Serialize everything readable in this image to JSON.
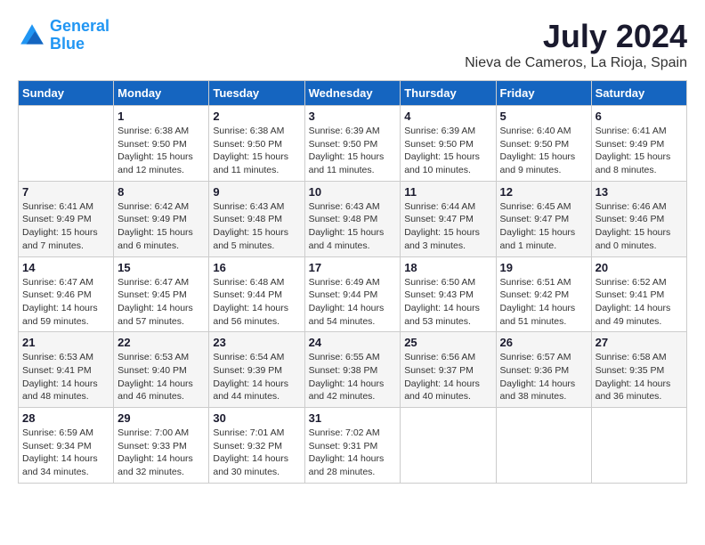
{
  "header": {
    "logo_line1": "General",
    "logo_line2": "Blue",
    "month": "July 2024",
    "location": "Nieva de Cameros, La Rioja, Spain"
  },
  "days_of_week": [
    "Sunday",
    "Monday",
    "Tuesday",
    "Wednesday",
    "Thursday",
    "Friday",
    "Saturday"
  ],
  "weeks": [
    [
      {
        "day": "",
        "content": ""
      },
      {
        "day": "1",
        "content": "Sunrise: 6:38 AM\nSunset: 9:50 PM\nDaylight: 15 hours and 12 minutes."
      },
      {
        "day": "2",
        "content": "Sunrise: 6:38 AM\nSunset: 9:50 PM\nDaylight: 15 hours and 11 minutes."
      },
      {
        "day": "3",
        "content": "Sunrise: 6:39 AM\nSunset: 9:50 PM\nDaylight: 15 hours and 11 minutes."
      },
      {
        "day": "4",
        "content": "Sunrise: 6:39 AM\nSunset: 9:50 PM\nDaylight: 15 hours and 10 minutes."
      },
      {
        "day": "5",
        "content": "Sunrise: 6:40 AM\nSunset: 9:50 PM\nDaylight: 15 hours and 9 minutes."
      },
      {
        "day": "6",
        "content": "Sunrise: 6:41 AM\nSunset: 9:49 PM\nDaylight: 15 hours and 8 minutes."
      }
    ],
    [
      {
        "day": "7",
        "content": "Sunrise: 6:41 AM\nSunset: 9:49 PM\nDaylight: 15 hours and 7 minutes."
      },
      {
        "day": "8",
        "content": "Sunrise: 6:42 AM\nSunset: 9:49 PM\nDaylight: 15 hours and 6 minutes."
      },
      {
        "day": "9",
        "content": "Sunrise: 6:43 AM\nSunset: 9:48 PM\nDaylight: 15 hours and 5 minutes."
      },
      {
        "day": "10",
        "content": "Sunrise: 6:43 AM\nSunset: 9:48 PM\nDaylight: 15 hours and 4 minutes."
      },
      {
        "day": "11",
        "content": "Sunrise: 6:44 AM\nSunset: 9:47 PM\nDaylight: 15 hours and 3 minutes."
      },
      {
        "day": "12",
        "content": "Sunrise: 6:45 AM\nSunset: 9:47 PM\nDaylight: 15 hours and 1 minute."
      },
      {
        "day": "13",
        "content": "Sunrise: 6:46 AM\nSunset: 9:46 PM\nDaylight: 15 hours and 0 minutes."
      }
    ],
    [
      {
        "day": "14",
        "content": "Sunrise: 6:47 AM\nSunset: 9:46 PM\nDaylight: 14 hours and 59 minutes."
      },
      {
        "day": "15",
        "content": "Sunrise: 6:47 AM\nSunset: 9:45 PM\nDaylight: 14 hours and 57 minutes."
      },
      {
        "day": "16",
        "content": "Sunrise: 6:48 AM\nSunset: 9:44 PM\nDaylight: 14 hours and 56 minutes."
      },
      {
        "day": "17",
        "content": "Sunrise: 6:49 AM\nSunset: 9:44 PM\nDaylight: 14 hours and 54 minutes."
      },
      {
        "day": "18",
        "content": "Sunrise: 6:50 AM\nSunset: 9:43 PM\nDaylight: 14 hours and 53 minutes."
      },
      {
        "day": "19",
        "content": "Sunrise: 6:51 AM\nSunset: 9:42 PM\nDaylight: 14 hours and 51 minutes."
      },
      {
        "day": "20",
        "content": "Sunrise: 6:52 AM\nSunset: 9:41 PM\nDaylight: 14 hours and 49 minutes."
      }
    ],
    [
      {
        "day": "21",
        "content": "Sunrise: 6:53 AM\nSunset: 9:41 PM\nDaylight: 14 hours and 48 minutes."
      },
      {
        "day": "22",
        "content": "Sunrise: 6:53 AM\nSunset: 9:40 PM\nDaylight: 14 hours and 46 minutes."
      },
      {
        "day": "23",
        "content": "Sunrise: 6:54 AM\nSunset: 9:39 PM\nDaylight: 14 hours and 44 minutes."
      },
      {
        "day": "24",
        "content": "Sunrise: 6:55 AM\nSunset: 9:38 PM\nDaylight: 14 hours and 42 minutes."
      },
      {
        "day": "25",
        "content": "Sunrise: 6:56 AM\nSunset: 9:37 PM\nDaylight: 14 hours and 40 minutes."
      },
      {
        "day": "26",
        "content": "Sunrise: 6:57 AM\nSunset: 9:36 PM\nDaylight: 14 hours and 38 minutes."
      },
      {
        "day": "27",
        "content": "Sunrise: 6:58 AM\nSunset: 9:35 PM\nDaylight: 14 hours and 36 minutes."
      }
    ],
    [
      {
        "day": "28",
        "content": "Sunrise: 6:59 AM\nSunset: 9:34 PM\nDaylight: 14 hours and 34 minutes."
      },
      {
        "day": "29",
        "content": "Sunrise: 7:00 AM\nSunset: 9:33 PM\nDaylight: 14 hours and 32 minutes."
      },
      {
        "day": "30",
        "content": "Sunrise: 7:01 AM\nSunset: 9:32 PM\nDaylight: 14 hours and 30 minutes."
      },
      {
        "day": "31",
        "content": "Sunrise: 7:02 AM\nSunset: 9:31 PM\nDaylight: 14 hours and 28 minutes."
      },
      {
        "day": "",
        "content": ""
      },
      {
        "day": "",
        "content": ""
      },
      {
        "day": "",
        "content": ""
      }
    ]
  ]
}
